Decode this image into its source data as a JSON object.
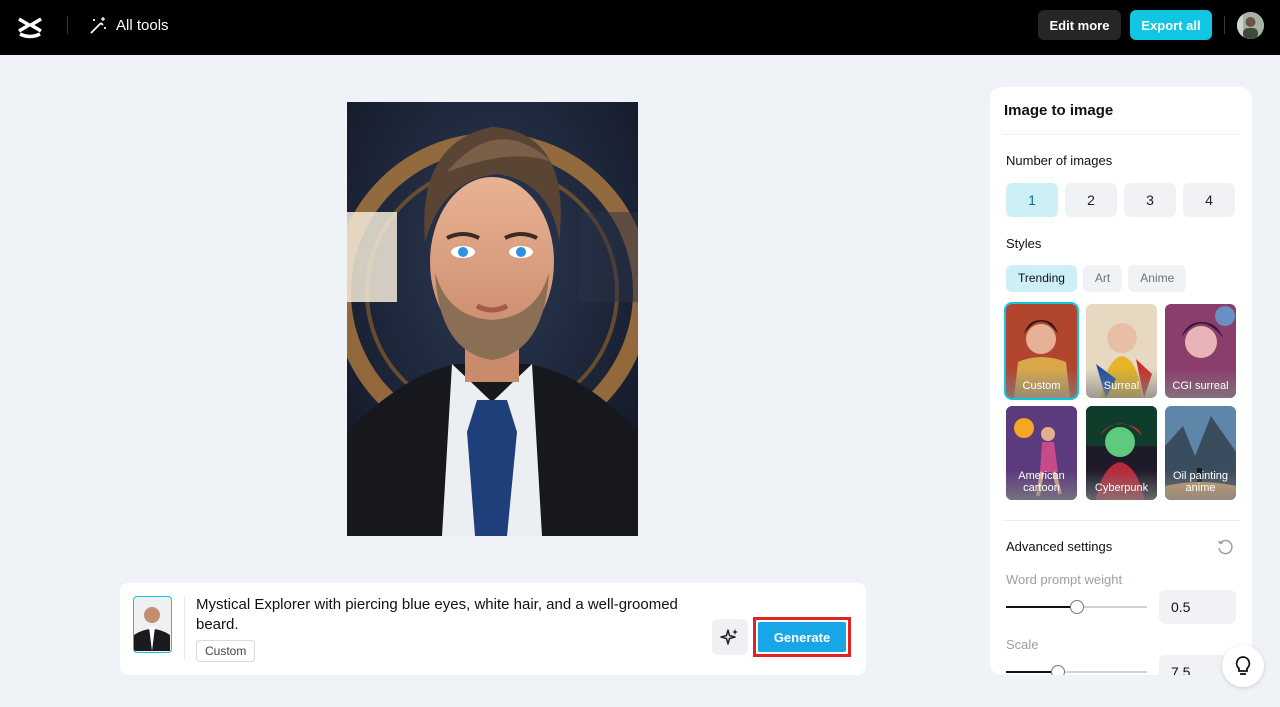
{
  "header": {
    "all_tools_label": "All tools",
    "edit_more_label": "Edit more",
    "export_all_label": "Export all",
    "logo_icon": "capcut-logo-icon",
    "tools_icon": "magic-wand-icon"
  },
  "prompt": {
    "text": "Mystical Explorer with piercing blue eyes, white hair, and a well-groomed beard.",
    "style_chip": "Custom",
    "generate_label": "Generate",
    "magic_icon": "sparkle-icon"
  },
  "panel": {
    "title": "Image to image",
    "number_of_images_label": "Number of images",
    "number_options": [
      "1",
      "2",
      "3",
      "4"
    ],
    "selected_number": "1",
    "styles_label": "Styles",
    "style_tabs": [
      "Trending",
      "Art",
      "Anime"
    ],
    "active_tab": "Trending",
    "styles": [
      {
        "label": "Custom",
        "selected": true
      },
      {
        "label": "Surreal",
        "selected": false
      },
      {
        "label": "CGI surreal",
        "selected": false
      },
      {
        "label": "American cartoon",
        "selected": false
      },
      {
        "label": "Cyberpunk",
        "selected": false
      },
      {
        "label": "Oil painting anime",
        "selected": false
      }
    ],
    "advanced_settings_label": "Advanced settings",
    "word_prompt_weight_label": "Word prompt weight",
    "word_prompt_weight_value": "0.5",
    "word_prompt_weight_fraction": 0.5,
    "scale_label": "Scale",
    "scale_value": "7.5",
    "scale_fraction": 0.37
  },
  "colors": {
    "accent": "#10c6e3",
    "generate": "#18a7e6",
    "highlight_border": "#e02424"
  }
}
